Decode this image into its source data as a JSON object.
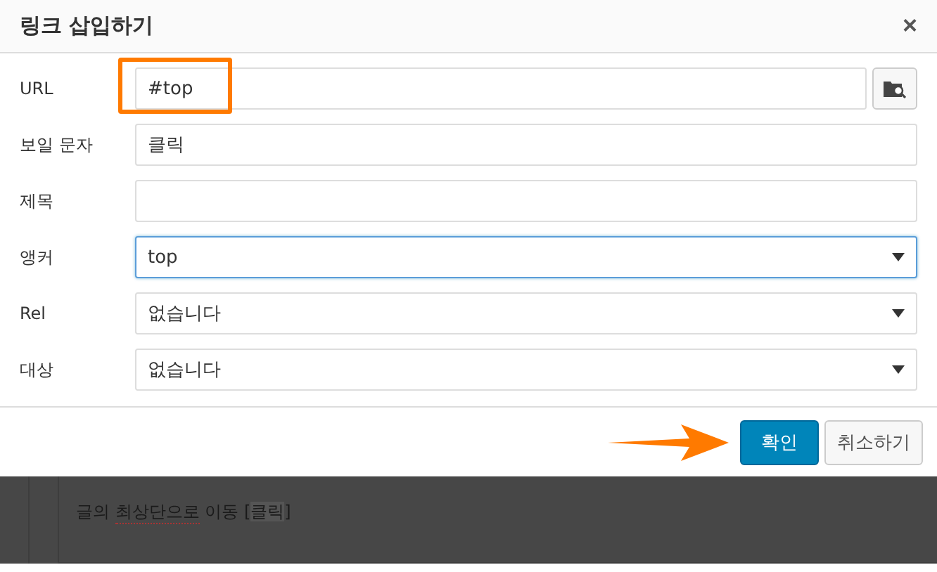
{
  "dialog": {
    "title": "링크 삽입하기",
    "close": "×"
  },
  "fields": [
    {
      "label": "URL",
      "kind": "url",
      "value": "#top",
      "highlighted": true,
      "focused": false
    },
    {
      "label": "보일 문자",
      "kind": "text",
      "value": "클릭",
      "highlighted": false,
      "focused": false
    },
    {
      "label": "제목",
      "kind": "text",
      "highlighted": false,
      "focused": false
    },
    {
      "label": "앵커",
      "kind": "select",
      "value": "top",
      "highlighted": false,
      "focused": true
    },
    {
      "label": "Rel",
      "kind": "select",
      "value": "없습니다",
      "highlighted": false,
      "focused": false
    },
    {
      "label": "대상",
      "kind": "select",
      "value": "없습니다",
      "highlighted": false,
      "focused": false
    }
  ],
  "buttons": [
    {
      "label": "확인",
      "primary": true,
      "pointed": true
    },
    {
      "label": "취소하기",
      "primary": false,
      "pointed": false
    }
  ],
  "background_text": [
    {
      "text": "글의 ",
      "kind": "plain"
    },
    {
      "text": "최상단으로",
      "kind": "misspelled"
    },
    {
      "text": " 이동 [",
      "kind": "plain"
    },
    {
      "text": "클릭",
      "kind": "selected"
    },
    {
      "text": "]",
      "kind": "plain"
    }
  ]
}
